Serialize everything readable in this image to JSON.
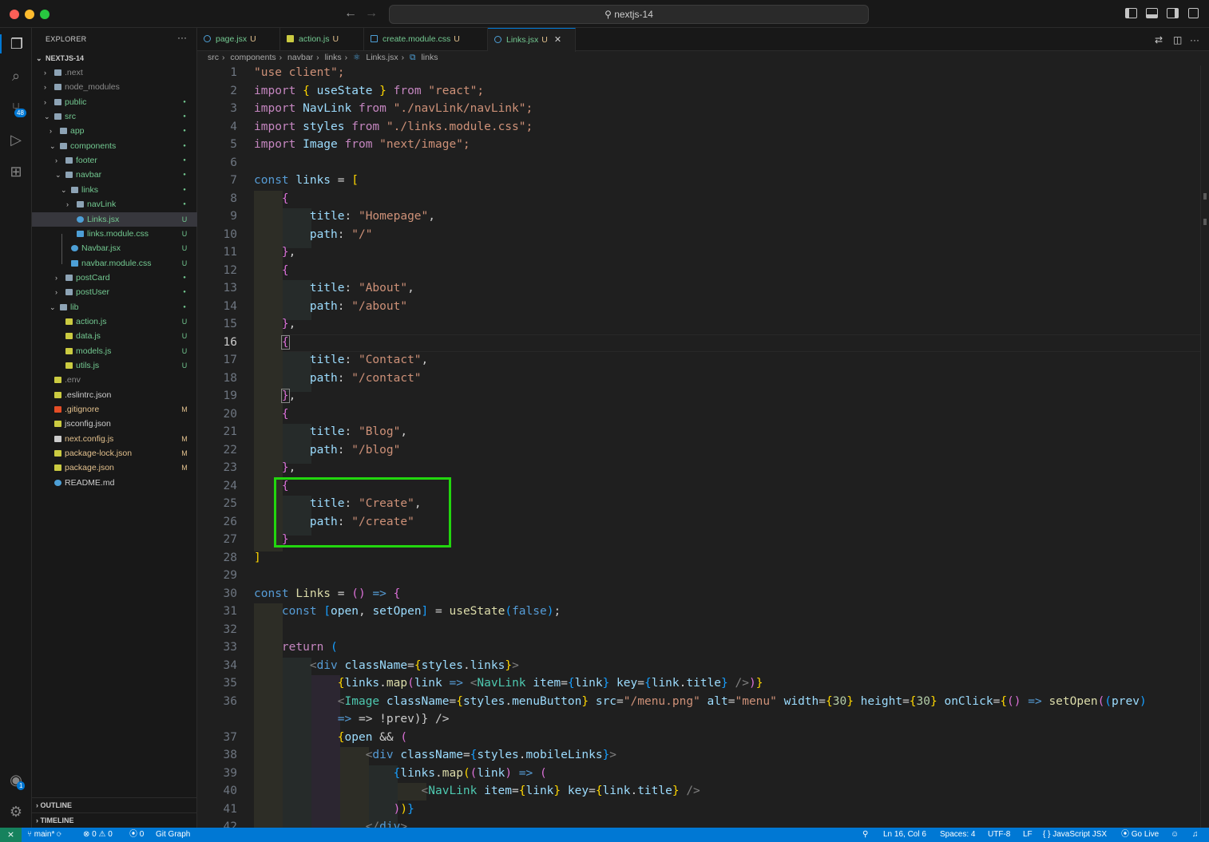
{
  "window": {
    "title": "nextjs-14"
  },
  "explorer": {
    "title": "EXPLORER",
    "root": "NEXTJS-14",
    "outline": "OUTLINE",
    "timeline": "TIMELINE"
  },
  "tree": [
    {
      "label": ".next",
      "status": "",
      "color": "#8a8a8a"
    },
    {
      "label": "node_modules",
      "status": "",
      "color": "#8a8a8a"
    },
    {
      "label": "public",
      "status": "●",
      "color": "#73c991"
    },
    {
      "label": "src",
      "status": "●",
      "color": "#73c991"
    },
    {
      "label": "app",
      "status": "●",
      "color": "#73c991"
    },
    {
      "label": "components",
      "status": "●",
      "color": "#73c991"
    },
    {
      "label": "footer",
      "status": "●",
      "color": "#73c991"
    },
    {
      "label": "navbar",
      "status": "●",
      "color": "#73c991"
    },
    {
      "label": "links",
      "status": "●",
      "color": "#73c991"
    },
    {
      "label": "navLink",
      "status": "●",
      "color": "#73c991"
    },
    {
      "label": "Links.jsx",
      "status": "U",
      "color": "#73c991"
    },
    {
      "label": "links.module.css",
      "status": "U",
      "color": "#73c991"
    },
    {
      "label": "Navbar.jsx",
      "status": "U",
      "color": "#73c991"
    },
    {
      "label": "navbar.module.css",
      "status": "U",
      "color": "#73c991"
    },
    {
      "label": "postCard",
      "status": "●",
      "color": "#73c991"
    },
    {
      "label": "postUser",
      "status": "●",
      "color": "#73c991"
    },
    {
      "label": "lib",
      "status": "●",
      "color": "#73c991"
    },
    {
      "label": "action.js",
      "status": "U",
      "color": "#73c991"
    },
    {
      "label": "data.js",
      "status": "U",
      "color": "#73c991"
    },
    {
      "label": "models.js",
      "status": "U",
      "color": "#73c991"
    },
    {
      "label": "utils.js",
      "status": "U",
      "color": "#73c991"
    },
    {
      "label": ".env",
      "status": "",
      "color": "#8a8a8a"
    },
    {
      "label": ".eslintrc.json",
      "status": "",
      "color": "#cccccc"
    },
    {
      "label": ".gitignore",
      "status": "M",
      "color": "#e2c08d"
    },
    {
      "label": "jsconfig.json",
      "status": "",
      "color": "#cccccc"
    },
    {
      "label": "next.config.js",
      "status": "M",
      "color": "#e2c08d"
    },
    {
      "label": "package-lock.json",
      "status": "M",
      "color": "#e2c08d"
    },
    {
      "label": "package.json",
      "status": "M",
      "color": "#e2c08d"
    },
    {
      "label": "README.md",
      "status": "",
      "color": "#cccccc"
    }
  ],
  "tabs": [
    {
      "label": "page.jsx",
      "status": "U"
    },
    {
      "label": "action.js",
      "status": "U"
    },
    {
      "label": "create.module.css",
      "status": "U"
    },
    {
      "label": "Links.jsx",
      "status": "U",
      "close": "✕"
    }
  ],
  "breadcrumb": [
    "src",
    "components",
    "navbar",
    "links",
    "Links.jsx",
    "links"
  ],
  "line_numbers": [
    "1",
    "2",
    "3",
    "4",
    "5",
    "6",
    "7",
    "8",
    "9",
    "10",
    "11",
    "12",
    "13",
    "14",
    "15",
    "16",
    "17",
    "18",
    "19",
    "20",
    "21",
    "22",
    "23",
    "24",
    "25",
    "26",
    "27",
    "28",
    "29",
    "30",
    "31",
    "32",
    "33",
    "34",
    "35",
    "36",
    "37",
    "38",
    "39",
    "40",
    "41",
    "42"
  ],
  "code": {
    "l1": [
      "\"use client\";"
    ],
    "l2": [
      "import",
      " ",
      "{",
      " useState ",
      "}",
      " from ",
      "\"react\";"
    ],
    "l3": [
      "import",
      " NavLink ",
      "from",
      " ",
      "\"./navLink/navLink\";"
    ],
    "l4": [
      "import",
      " styles ",
      "from",
      " ",
      "\"./links.module.css\";"
    ],
    "l5": [
      "import",
      " Image ",
      "from",
      " ",
      "\"next/image\";"
    ],
    "l7": [
      "const",
      " links ",
      "=",
      " ",
      "["
    ],
    "t_homepage": "\"Homepage\"",
    "p_root": "\"/\"",
    "t_about": "\"About\"",
    "p_about": "\"/about\"",
    "t_contact": "\"Contact\"",
    "p_contact": "\"/contact\"",
    "t_blog": "\"Blog\"",
    "p_blog": "\"/blog\"",
    "t_create": "\"Create\"",
    "p_create": "\"/create\"",
    "l36b": "=> !prev)} />"
  },
  "status": {
    "branch": "main*",
    "errors": "0",
    "warnings": "0",
    "ports": "0",
    "git_graph": "Git Graph",
    "position": "Ln 16, Col 6",
    "spaces": "Spaces: 4",
    "encoding": "UTF-8",
    "eol": "LF",
    "language": "JavaScript JSX",
    "golive": "Go Live"
  },
  "badges": {
    "scm": "48",
    "account": "1"
  }
}
